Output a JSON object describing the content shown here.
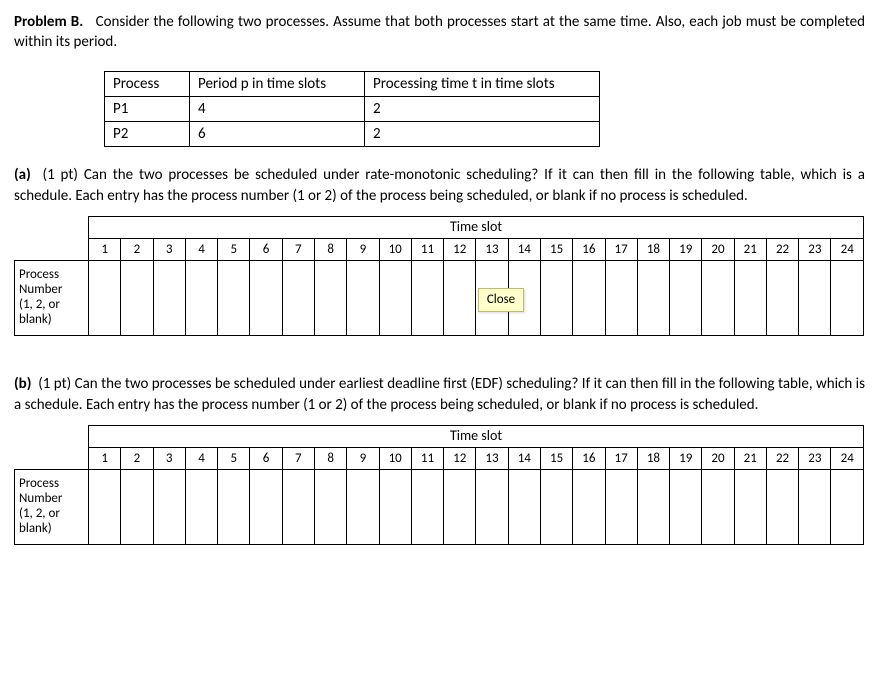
{
  "problem": {
    "label": "Problem B.",
    "intro": "Consider the following two processes.  Assume that both processes start at the same time.  Also, each job must be completed within its period."
  },
  "processTable": {
    "headers": {
      "process": "Process",
      "period": "Period p in time slots",
      "ptime": "Processing time t in time slots"
    },
    "rows": [
      {
        "process": "P1",
        "period": "4",
        "ptime": "2"
      },
      {
        "process": "P2",
        "period": "6",
        "ptime": "2"
      }
    ]
  },
  "partA": {
    "label": "(a)",
    "points": "(1 pt)",
    "text": "Can the two processes be scheduled under rate-monotonic scheduling?  If it can then fill in the following table, which is a schedule.  Each entry has the process number (1 or 2) of the process being scheduled, or blank if no process is scheduled."
  },
  "partB": {
    "label": "(b)",
    "points": "(1 pt)",
    "text": "Can the two processes be scheduled under earliest deadline first (EDF) scheduling?  If it can then fill in the following table, which is a schedule.  Each entry has the process number (1 or 2) of the process being scheduled, or blank if no process is scheduled."
  },
  "schedule": {
    "header": "Time slot",
    "slots": [
      "1",
      "2",
      "3",
      "4",
      "5",
      "6",
      "7",
      "8",
      "9",
      "10",
      "11",
      "12",
      "13",
      "14",
      "15",
      "16",
      "17",
      "18",
      "19",
      "20",
      "21",
      "22",
      "23",
      "24"
    ],
    "rowLabel1": "Process",
    "rowLabel2": "Number",
    "rowLabel3": "(1, 2, or",
    "rowLabel4": "blank)"
  },
  "tooltip": {
    "close": "Close"
  },
  "chart_data": [
    {
      "type": "table",
      "title": "Process parameters",
      "columns": [
        "Process",
        "Period p in time slots",
        "Processing time t in time slots"
      ],
      "rows": [
        [
          "P1",
          4,
          2
        ],
        [
          "P2",
          6,
          2
        ]
      ]
    },
    {
      "type": "table",
      "title": "Rate-monotonic schedule (blank)",
      "columns": [
        "Time slot",
        "Process Number (1, 2, or blank)"
      ],
      "rows": [
        [
          1,
          ""
        ],
        [
          2,
          ""
        ],
        [
          3,
          ""
        ],
        [
          4,
          ""
        ],
        [
          5,
          ""
        ],
        [
          6,
          ""
        ],
        [
          7,
          ""
        ],
        [
          8,
          ""
        ],
        [
          9,
          ""
        ],
        [
          10,
          ""
        ],
        [
          11,
          ""
        ],
        [
          12,
          ""
        ],
        [
          13,
          ""
        ],
        [
          14,
          ""
        ],
        [
          15,
          ""
        ],
        [
          16,
          ""
        ],
        [
          17,
          ""
        ],
        [
          18,
          ""
        ],
        [
          19,
          ""
        ],
        [
          20,
          ""
        ],
        [
          21,
          ""
        ],
        [
          22,
          ""
        ],
        [
          23,
          ""
        ],
        [
          24,
          ""
        ]
      ]
    },
    {
      "type": "table",
      "title": "EDF schedule (blank)",
      "columns": [
        "Time slot",
        "Process Number (1, 2, or blank)"
      ],
      "rows": [
        [
          1,
          ""
        ],
        [
          2,
          ""
        ],
        [
          3,
          ""
        ],
        [
          4,
          ""
        ],
        [
          5,
          ""
        ],
        [
          6,
          ""
        ],
        [
          7,
          ""
        ],
        [
          8,
          ""
        ],
        [
          9,
          ""
        ],
        [
          10,
          ""
        ],
        [
          11,
          ""
        ],
        [
          12,
          ""
        ],
        [
          13,
          ""
        ],
        [
          14,
          ""
        ],
        [
          15,
          ""
        ],
        [
          16,
          ""
        ],
        [
          17,
          ""
        ],
        [
          18,
          ""
        ],
        [
          19,
          ""
        ],
        [
          20,
          ""
        ],
        [
          21,
          ""
        ],
        [
          22,
          ""
        ],
        [
          23,
          ""
        ],
        [
          24,
          ""
        ]
      ]
    }
  ]
}
